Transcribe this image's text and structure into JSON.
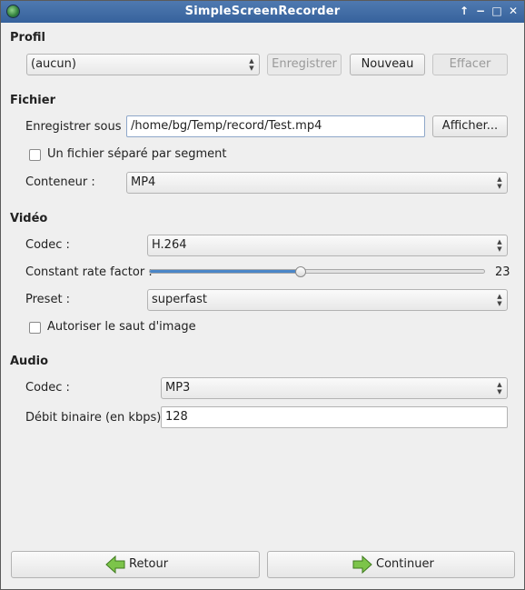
{
  "window": {
    "title": "SimpleScreenRecorder",
    "controls": [
      "↑",
      "−",
      "□",
      "✕"
    ]
  },
  "profile": {
    "heading": "Profil",
    "selected": "(aucun)",
    "save_label": "Enregistrer",
    "new_label": "Nouveau",
    "delete_label": "Effacer"
  },
  "file": {
    "heading": "Fichier",
    "save_as_label": "Enregistrer sous :",
    "path_value": "/home/bg/Temp/record/Test.mp4",
    "browse_label": "Afficher...",
    "separate_file_label": "Un fichier séparé par segment",
    "separate_file_checked": false,
    "container_label": "Conteneur :",
    "container_value": "MP4"
  },
  "video": {
    "heading": "Vidéo",
    "codec_label": "Codec :",
    "codec_value": "H.264",
    "crf_label": "Constant rate factor :",
    "crf_value": "23",
    "crf_min": 0,
    "crf_max": 51,
    "preset_label": "Preset :",
    "preset_value": "superfast",
    "skip_frames_label": "Autoriser le saut d'image",
    "skip_frames_checked": false
  },
  "audio": {
    "heading": "Audio",
    "codec_label": "Codec :",
    "codec_value": "MP3",
    "bitrate_label": "Débit binaire (en kbps) :",
    "bitrate_value": "128"
  },
  "footer": {
    "back_label": "Retour",
    "continue_label": "Continuer"
  },
  "colors": {
    "titlebar": "#3f6ba5",
    "accent": "#4a86c8",
    "arrow_green": "#7cc44a"
  }
}
